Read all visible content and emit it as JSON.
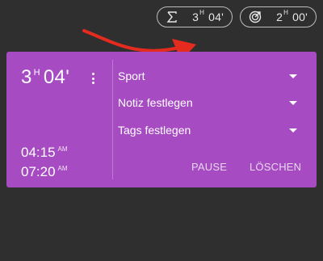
{
  "stats": {
    "total": {
      "icon": "sigma-icon",
      "hours": "3",
      "hour_unit": "H",
      "minutes": "04'"
    },
    "target": {
      "icon": "target-icon",
      "hours": "2",
      "hour_unit": "H",
      "minutes": "00'"
    }
  },
  "annotation": {
    "icon": "red-arrow",
    "color": "#e52b1e"
  },
  "card": {
    "background": "#a64bc2",
    "duration": {
      "hours": "3",
      "hour_unit": "H",
      "minutes": "04'"
    },
    "start": {
      "time": "04:15",
      "ampm": "AM"
    },
    "end": {
      "time": "07:20",
      "ampm": "AM"
    },
    "fields": {
      "category": "Sport",
      "note": "Notiz festlegen",
      "tags": "Tags festlegen"
    },
    "actions": {
      "pause": "PAUSE",
      "delete": "LÖSCHEN"
    }
  }
}
